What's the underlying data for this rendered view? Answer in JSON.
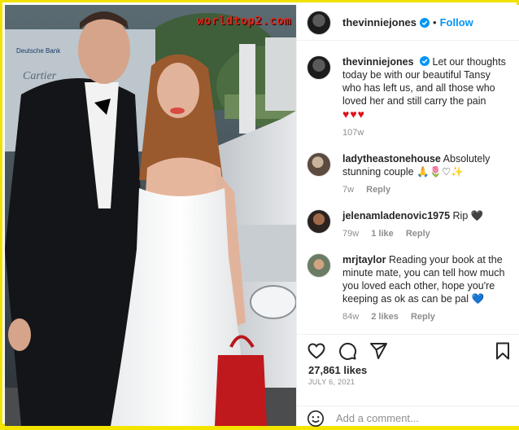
{
  "photo": {
    "watermark": "worldtop2.com",
    "backdrop_logo_1": "Deutsche Bank",
    "backdrop_logo_2": "Cartier"
  },
  "header": {
    "username": "thevinniejones",
    "dot": "•",
    "follow_label": "Follow"
  },
  "caption": {
    "username": "thevinniejones",
    "text": "Let our thoughts today be with our beautiful Tansy who has left us, and all those who loved her and still carry the pain",
    "emoji": "♥♥♥",
    "time": "107w"
  },
  "comments": [
    {
      "username": "ladytheastonehouse",
      "text": "Absolutely stunning couple 🙏🌷♡✨",
      "time": "7w",
      "likes": "",
      "reply": "Reply"
    },
    {
      "username": "jelenamladenovic1975",
      "text": "Rip 🖤",
      "time": "79w",
      "likes": "1 like",
      "reply": "Reply"
    },
    {
      "username": "mrjtaylor",
      "text": "Reading your book at the minute mate, you can tell how much you loved each other, hope you're keeping as ok as can be pal 💙",
      "time": "84w",
      "likes": "2 likes",
      "reply": "Reply"
    }
  ],
  "stats": {
    "likes": "27,861 likes",
    "date": "JULY 6, 2021"
  },
  "add_comment": {
    "placeholder": "Add a comment..."
  },
  "colors": {
    "accent": "#0095f6",
    "frame": "#f1e200",
    "heart": "#e0101a"
  }
}
